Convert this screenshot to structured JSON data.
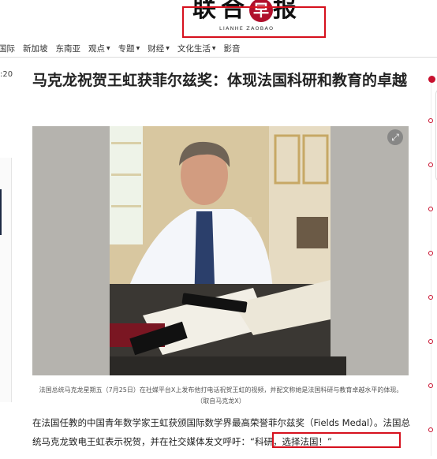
{
  "masthead": {
    "logo_left": "联合",
    "logo_mid": "早",
    "logo_right": "报",
    "logo_en": "LIANHE ZAOBAO"
  },
  "nav": {
    "items": [
      {
        "label": "国际",
        "dropdown": false
      },
      {
        "label": "新加坡",
        "dropdown": false
      },
      {
        "label": "东南亚",
        "dropdown": false
      },
      {
        "label": "观点",
        "dropdown": true
      },
      {
        "label": "专题",
        "dropdown": true
      },
      {
        "label": "财经",
        "dropdown": true
      },
      {
        "label": "文化生活",
        "dropdown": true
      },
      {
        "label": "影音",
        "dropdown": false
      }
    ]
  },
  "left": {
    "time_fragment": ":20"
  },
  "article": {
    "title": "马克龙祝贺王虹获菲尔兹奖：体现法国科研和教育的卓越",
    "caption": "法国总统马克龙星期五（7月25日）在社媒平台X上发布他打电话祝贺王虹的视频，并配文称她是法国科研与教育卓越水平的体现。（取自马克龙X）",
    "body": "在法国任教的中国青年数学家王虹获颁国际数学界最高荣誉菲尔兹奖（Fields Medal）。法国总统马克龙致电王虹表示祝贺，并在社交媒体发文呼吁：“科研，选择法国！”"
  },
  "colors": {
    "brand": "#c8102e",
    "highlight_box": "#d6101d"
  },
  "icons": {
    "expand": "expand-icon"
  }
}
